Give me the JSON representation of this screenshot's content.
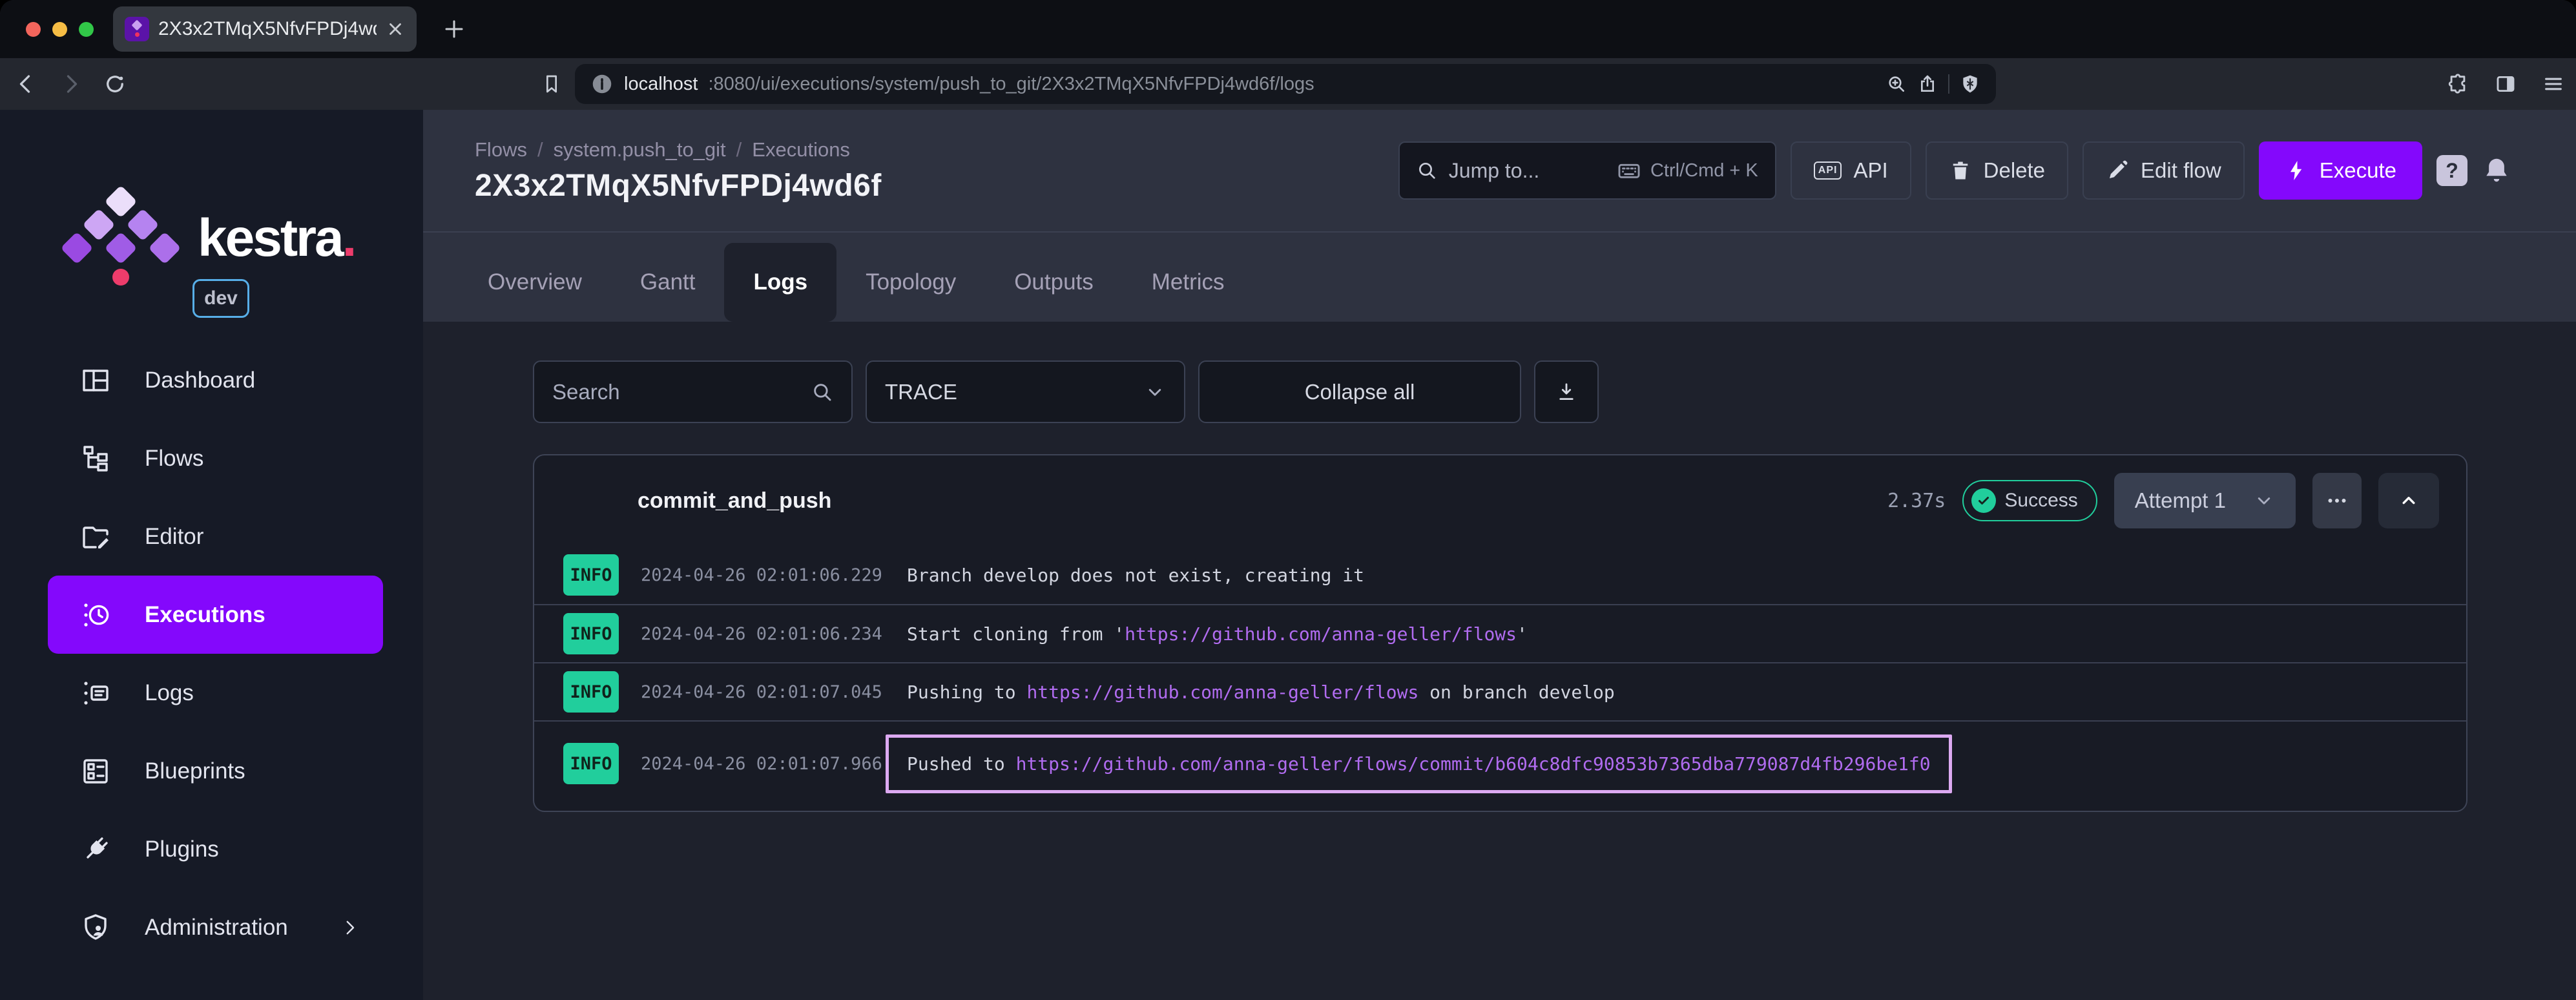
{
  "browser": {
    "tab": {
      "title": "2X3x2TMqX5NfvFPDj4wd6f |"
    },
    "url": {
      "host": "localhost",
      "path": ":8080/ui/executions/system/push_to_git/2X3x2TMqX5NfvFPDj4wd6f/logs"
    }
  },
  "sidebar": {
    "brand": "kestra",
    "brand_dot": ".",
    "env": "dev",
    "items": [
      {
        "id": "dashboard",
        "label": "Dashboard",
        "icon": "dashboard-icon",
        "active": false,
        "chevron": false
      },
      {
        "id": "flows",
        "label": "Flows",
        "icon": "flows-icon",
        "active": false,
        "chevron": false
      },
      {
        "id": "editor",
        "label": "Editor",
        "icon": "editor-icon",
        "active": false,
        "chevron": false
      },
      {
        "id": "executions",
        "label": "Executions",
        "icon": "executions-icon",
        "active": true,
        "chevron": false
      },
      {
        "id": "logs",
        "label": "Logs",
        "icon": "logs-icon",
        "active": false,
        "chevron": false
      },
      {
        "id": "blueprints",
        "label": "Blueprints",
        "icon": "blueprints-icon",
        "active": false,
        "chevron": false
      },
      {
        "id": "plugins",
        "label": "Plugins",
        "icon": "plugins-icon",
        "active": false,
        "chevron": false
      },
      {
        "id": "administration",
        "label": "Administration",
        "icon": "administration-icon",
        "active": false,
        "chevron": true
      }
    ]
  },
  "header": {
    "breadcrumb": [
      "Flows",
      "system.push_to_git",
      "Executions"
    ],
    "title": "2X3x2TMqX5NfvFPDj4wd6f",
    "jump_to": {
      "label": "Jump to...",
      "shortcut": "Ctrl/Cmd + K"
    },
    "api_label": "API",
    "delete_label": "Delete",
    "edit_flow_label": "Edit flow",
    "execute_label": "Execute",
    "help_label": "?"
  },
  "tabs": [
    {
      "label": "Overview",
      "active": false
    },
    {
      "label": "Gantt",
      "active": false
    },
    {
      "label": "Logs",
      "active": true
    },
    {
      "label": "Topology",
      "active": false
    },
    {
      "label": "Outputs",
      "active": false
    },
    {
      "label": "Metrics",
      "active": false
    }
  ],
  "controls": {
    "search_placeholder": "Search",
    "level": "TRACE",
    "collapse_all": "Collapse all"
  },
  "task_card": {
    "name": "commit_and_push",
    "duration": "2.37s",
    "status": "Success",
    "attempt": "Attempt 1",
    "logs": [
      {
        "level": "INFO",
        "ts": "2024-04-26 02:01:06.229",
        "highlighted": false,
        "parts": [
          {
            "t": "Branch develop does not exist, creating it",
            "link": false
          }
        ]
      },
      {
        "level": "INFO",
        "ts": "2024-04-26 02:01:06.234",
        "highlighted": false,
        "parts": [
          {
            "t": "Start cloning from '",
            "link": false
          },
          {
            "t": "https://github.com/anna-geller/flows",
            "link": true
          },
          {
            "t": "'",
            "link": false
          }
        ]
      },
      {
        "level": "INFO",
        "ts": "2024-04-26 02:01:07.045",
        "highlighted": false,
        "parts": [
          {
            "t": "Pushing to ",
            "link": false
          },
          {
            "t": "https://github.com/anna-geller/flows",
            "link": true
          },
          {
            "t": " on branch develop",
            "link": false
          }
        ]
      },
      {
        "level": "INFO",
        "ts": "2024-04-26 02:01:07.966",
        "highlighted": true,
        "parts": [
          {
            "t": "Pushed to ",
            "link": false
          },
          {
            "t": "https://github.com/anna-geller/flows/commit/b604c8dfc90853b7365dba779087d4fb296be1f0",
            "link": true
          }
        ]
      }
    ]
  },
  "colors": {
    "accent": "#8408FC",
    "success": "#21CE9C",
    "link": "#B16CF0",
    "highlight": "#DCA9F1",
    "brand_pink": "#ED3C6B",
    "env_badge_border": "#57AEE8"
  }
}
